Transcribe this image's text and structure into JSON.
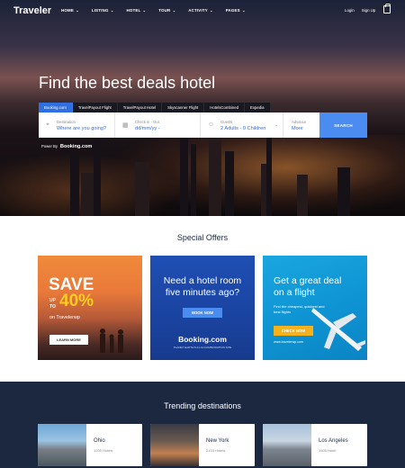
{
  "header": {
    "logo": "Traveler",
    "menu": [
      {
        "label": "HOME"
      },
      {
        "label": "LISTING"
      },
      {
        "label": "HOTEL"
      },
      {
        "label": "TOUR"
      },
      {
        "label": "ACTIVITY"
      },
      {
        "label": "PAGES"
      }
    ],
    "login": "Login",
    "signup": "Sign Up",
    "cart_icon": "shopping-bag-icon"
  },
  "hero": {
    "title": "Find the best deals hotel",
    "tabs": [
      "Booking.com",
      "TravelPayout Flight",
      "TravelPayout Hotel",
      "Skyscanner Flight",
      "HotelsCombined",
      "Expedia"
    ],
    "active_tab": "Booking.com",
    "search": {
      "destination_label": "Destination",
      "destination_placeholder": "Where are you going?",
      "dates_label": "Check in - Out",
      "dates_placeholder": "dd/mm/yy -",
      "guests_label": "Guests",
      "guests_value": "2 Adults - 0 Children",
      "advance_label": "Advance",
      "advance_value": "More",
      "search_button": "SEARCH"
    },
    "powered_by": "Power By",
    "powered_brand": "Booking.com"
  },
  "offers": {
    "title": "Special Offers",
    "card1": {
      "save": "SAVE",
      "upto": "UP",
      "to": "TO",
      "percent": "40%",
      "on": "on Travelerwp",
      "button": "LEARN MORE"
    },
    "card2": {
      "heading1": "Need a hotel room",
      "heading2": "five minutes ago?",
      "button": "BOOK NOW",
      "brand": "Booking.com",
      "brand_sub": "PLANET EARTH'S #1 ACCOMMODATION SITE"
    },
    "card3": {
      "heading1": "Get a great deal",
      "heading2": "on a flight",
      "text": "Find the cheapest, quickest and best flights",
      "button": "CHECK NOW",
      "site": "www.travelerwp.com"
    }
  },
  "trending": {
    "title": "Trending destinations",
    "destinations": [
      {
        "name": "Ohio",
        "count": "1205 Hotels"
      },
      {
        "name": "New York",
        "count": "2103 Hotels"
      },
      {
        "name": "Los Angeles",
        "count": "1505 Hotel"
      }
    ]
  }
}
